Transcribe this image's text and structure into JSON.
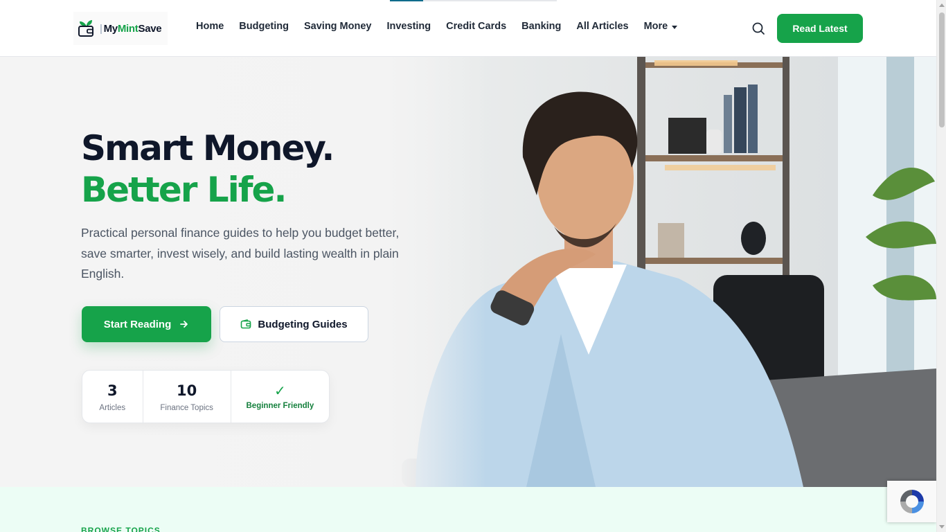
{
  "brand": {
    "name_part1": "My",
    "name_part2": "Mint",
    "name_part3": "Save"
  },
  "page_progress": 0.2,
  "nav": {
    "items": [
      {
        "label": "Home"
      },
      {
        "label": "Budgeting"
      },
      {
        "label": "Saving Money"
      },
      {
        "label": "Investing"
      },
      {
        "label": "Credit Cards"
      },
      {
        "label": "Banking"
      },
      {
        "label": "All Articles"
      }
    ],
    "more_label": "More"
  },
  "header": {
    "search_icon": "search-icon",
    "cta_label": "Read Latest"
  },
  "hero": {
    "title_line1": "Smart Money.",
    "title_line2": "Better Life.",
    "description": "Practical personal finance guides to help you budget better, save smarter, invest wisely, and build lasting wealth in plain English.",
    "primary_button": "Start Reading",
    "primary_icon": "arrow-right-icon",
    "secondary_button": "Budgeting Guides",
    "secondary_icon": "wallet-icon",
    "stats": [
      {
        "value": "3",
        "label": "Articles"
      },
      {
        "value": "10",
        "label": "Finance Topics"
      },
      {
        "value": "✓",
        "label": "Beginner Friendly"
      }
    ]
  },
  "topics": {
    "eyebrow": "BROWSE TOPICS"
  },
  "colors": {
    "accent": "#16a34a",
    "dark": "#0f172a",
    "topics_bg": "#ecfdf5"
  }
}
